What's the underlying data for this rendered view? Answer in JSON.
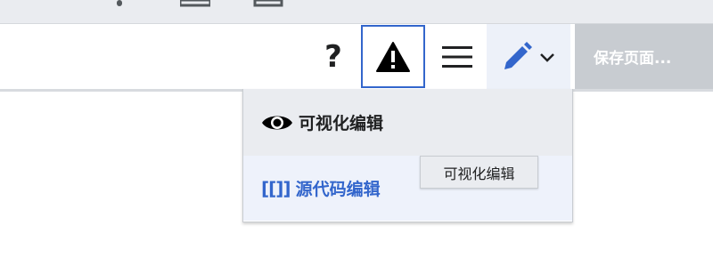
{
  "toolbar": {
    "help_label": "?",
    "save_label": "保存页面...",
    "icons": {
      "help": "help-icon",
      "notice": "alert-icon",
      "menu": "hamburger-menu-icon",
      "edit": "pencil-icon",
      "chevron": "chevron-down-icon"
    }
  },
  "edit_mode_menu": {
    "items": [
      {
        "label": "可视化编辑",
        "icon": "eye-icon",
        "state": "selected"
      },
      {
        "label": "源代码编辑",
        "icon": "[[]]",
        "state": "hovered"
      }
    ]
  },
  "tooltip": {
    "text": "可视化编辑"
  },
  "colors": {
    "accent": "#3366cc",
    "save_disabled": "#c8ccd1",
    "text": "#202122"
  }
}
